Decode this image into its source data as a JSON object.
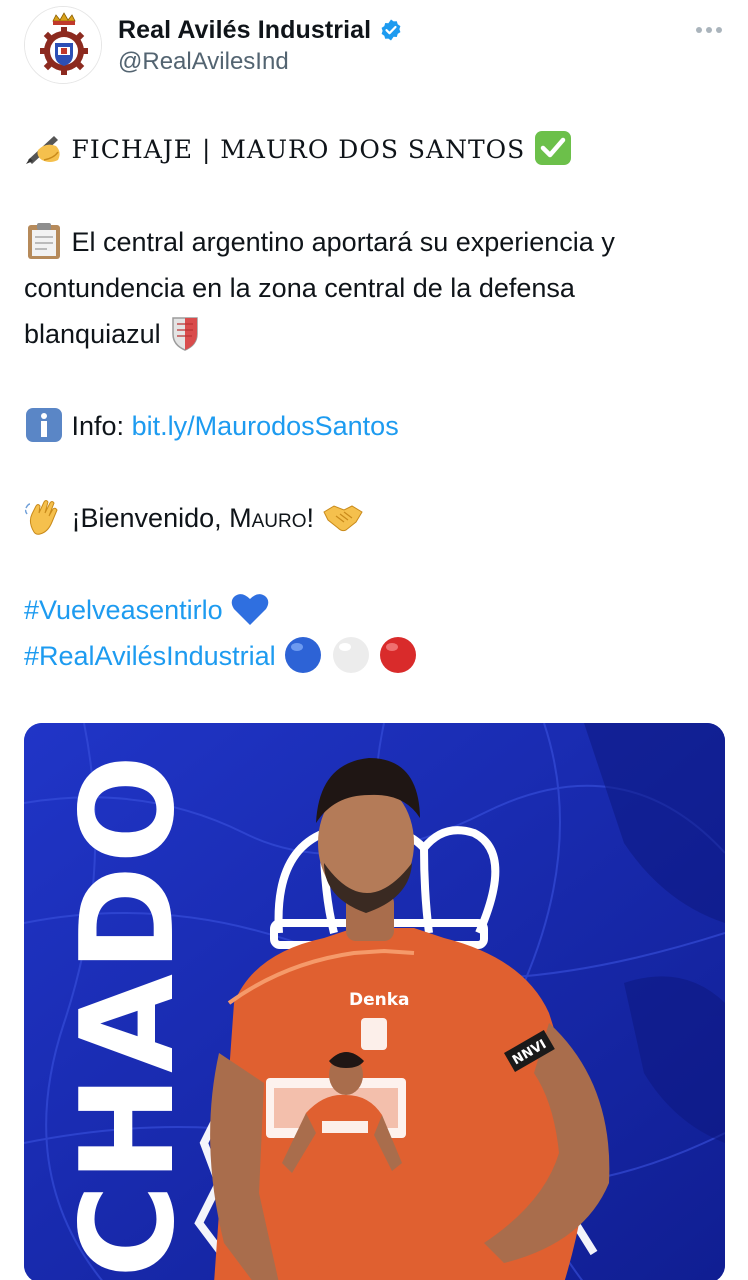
{
  "author": {
    "display_name": "Real Avilés Industrial",
    "handle": "@RealAvilesInd",
    "verified": true
  },
  "tweet": {
    "line1_text": "FICHAJE | MAURO DOS SANTOS",
    "line2a": "El central argentino aportará su experiencia y",
    "line2b": "contundencia en la zona central de la defensa",
    "line2c": "blanquiazul",
    "info_label": "Info: ",
    "info_link": "bit.ly/MaurodosSantos",
    "welcome_prefix": "¡Bienvenido, M",
    "welcome_sc": "auro",
    "welcome_suffix": "!",
    "hashtag1": "#Vuelveasentirlo",
    "hashtag2": "#RealAvilésIndustrial"
  },
  "media": {
    "vertical_text": "CHADO",
    "sponsor": "Denka",
    "sleeve_text": "NNVI"
  },
  "colors": {
    "link": "#1d9bf0",
    "media_blue": "#1c2fb8",
    "jersey": "#e06030",
    "verified": "#1d9bf0"
  },
  "icons": [
    "verified-badge-icon",
    "more-options-icon",
    "writing-hand-icon",
    "check-mark-icon",
    "clipboard-icon",
    "shield-icon",
    "info-icon",
    "waving-hand-icon",
    "handshake-icon",
    "blue-heart-icon",
    "blue-circle-icon",
    "white-circle-icon",
    "red-circle-icon"
  ]
}
